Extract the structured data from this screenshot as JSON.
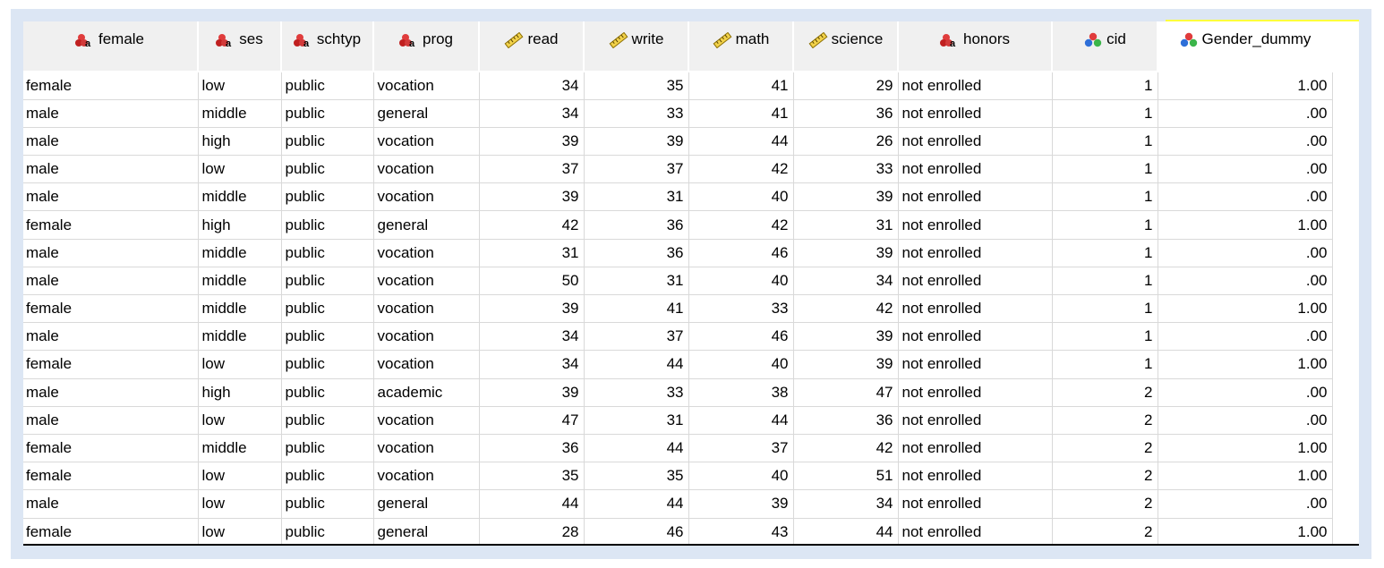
{
  "columns": [
    {
      "name": "female",
      "icon": "nominal-icon",
      "align": "str",
      "width": 196
    },
    {
      "name": "ses",
      "icon": "nominal-icon",
      "align": "str",
      "width": 93
    },
    {
      "name": "schtyp",
      "icon": "nominal-icon",
      "align": "str",
      "width": 103
    },
    {
      "name": "prog",
      "icon": "nominal-icon",
      "align": "str",
      "width": 118
    },
    {
      "name": "read",
      "icon": "scale-icon",
      "align": "num",
      "width": 117
    },
    {
      "name": "write",
      "icon": "scale-icon",
      "align": "num",
      "width": 117
    },
    {
      "name": "math",
      "icon": "scale-icon",
      "align": "num",
      "width": 117
    },
    {
      "name": "science",
      "icon": "scale-icon",
      "align": "num",
      "width": 117
    },
    {
      "name": "honors",
      "icon": "nominal-icon",
      "align": "str",
      "width": 172
    },
    {
      "name": "cid",
      "icon": "ordinal-icon",
      "align": "num",
      "width": 118
    },
    {
      "name": "Gender_dummy",
      "icon": "ordinal-icon",
      "align": "num",
      "width": 195
    }
  ],
  "rows": [
    [
      "female",
      "low",
      "public",
      "vocation",
      "34",
      "35",
      "41",
      "29",
      "not enrolled",
      "1",
      "1.00"
    ],
    [
      "male",
      "middle",
      "public",
      "general",
      "34",
      "33",
      "41",
      "36",
      "not enrolled",
      "1",
      ".00"
    ],
    [
      "male",
      "high",
      "public",
      "vocation",
      "39",
      "39",
      "44",
      "26",
      "not enrolled",
      "1",
      ".00"
    ],
    [
      "male",
      "low",
      "public",
      "vocation",
      "37",
      "37",
      "42",
      "33",
      "not enrolled",
      "1",
      ".00"
    ],
    [
      "male",
      "middle",
      "public",
      "vocation",
      "39",
      "31",
      "40",
      "39",
      "not enrolled",
      "1",
      ".00"
    ],
    [
      "female",
      "high",
      "public",
      "general",
      "42",
      "36",
      "42",
      "31",
      "not enrolled",
      "1",
      "1.00"
    ],
    [
      "male",
      "middle",
      "public",
      "vocation",
      "31",
      "36",
      "46",
      "39",
      "not enrolled",
      "1",
      ".00"
    ],
    [
      "male",
      "middle",
      "public",
      "vocation",
      "50",
      "31",
      "40",
      "34",
      "not enrolled",
      "1",
      ".00"
    ],
    [
      "female",
      "middle",
      "public",
      "vocation",
      "39",
      "41",
      "33",
      "42",
      "not enrolled",
      "1",
      "1.00"
    ],
    [
      "male",
      "middle",
      "public",
      "vocation",
      "34",
      "37",
      "46",
      "39",
      "not enrolled",
      "1",
      ".00"
    ],
    [
      "female",
      "low",
      "public",
      "vocation",
      "34",
      "44",
      "40",
      "39",
      "not enrolled",
      "1",
      "1.00"
    ],
    [
      "male",
      "high",
      "public",
      "academic",
      "39",
      "33",
      "38",
      "47",
      "not enrolled",
      "2",
      ".00"
    ],
    [
      "male",
      "low",
      "public",
      "vocation",
      "47",
      "31",
      "44",
      "36",
      "not enrolled",
      "2",
      ".00"
    ],
    [
      "female",
      "middle",
      "public",
      "vocation",
      "36",
      "44",
      "37",
      "42",
      "not enrolled",
      "2",
      "1.00"
    ],
    [
      "female",
      "low",
      "public",
      "vocation",
      "35",
      "35",
      "40",
      "51",
      "not enrolled",
      "2",
      "1.00"
    ],
    [
      "male",
      "low",
      "public",
      "general",
      "44",
      "44",
      "39",
      "34",
      "not enrolled",
      "2",
      ".00"
    ],
    [
      "female",
      "low",
      "public",
      "general",
      "28",
      "46",
      "43",
      "44",
      "not enrolled",
      "2",
      "1.00"
    ]
  ],
  "colors": {
    "highlight": "#ffff3c",
    "header_bg": "#f0f0f0",
    "frame_bg": "#dce6f4"
  }
}
